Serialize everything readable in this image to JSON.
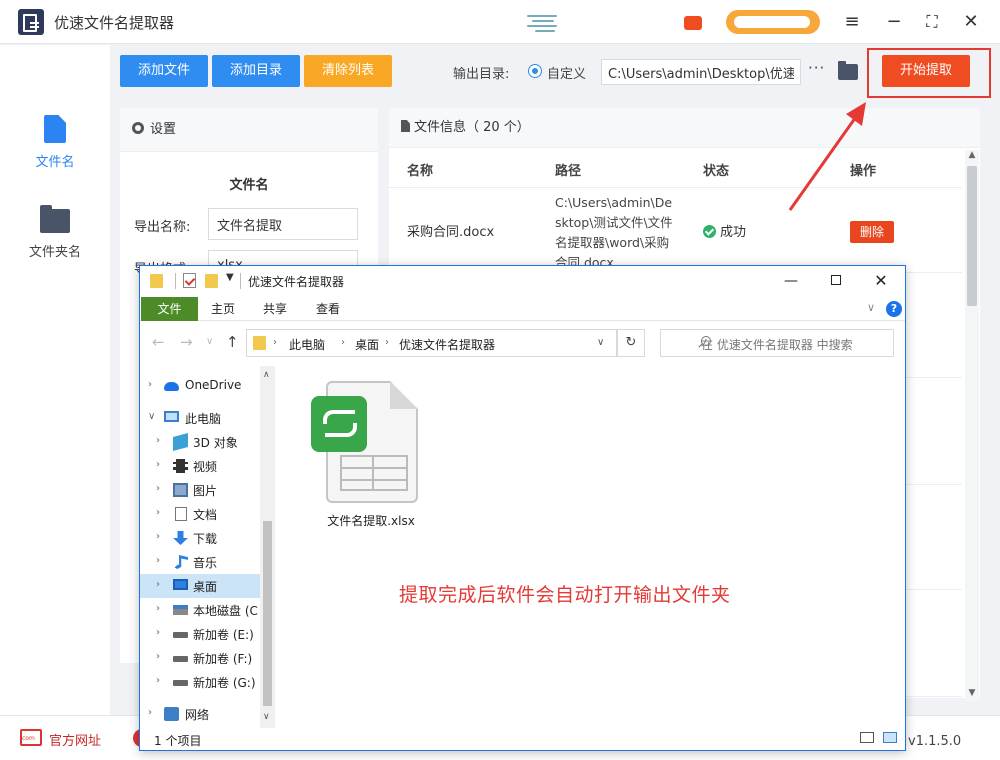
{
  "app": {
    "title": "优速文件名提取器"
  },
  "sidebar": {
    "items": [
      {
        "label": "文件名",
        "icon": "file-icon",
        "color": "#2c84f2"
      },
      {
        "label": "文件夹名",
        "icon": "folder-icon"
      }
    ]
  },
  "toolbar": {
    "add_file": "添加文件",
    "add_dir": "添加目录",
    "clear_list": "清除列表",
    "output_label": "输出目录:",
    "radio_custom": "自定义",
    "output_path": "C:\\Users\\admin\\Desktop\\优速",
    "more": "···",
    "start": "开始提取"
  },
  "settings": {
    "title": "设置",
    "subtitle": "文件名",
    "export_name_label": "导出名称:",
    "export_name_value": "文件名提取",
    "export_format_label": "导出格式:",
    "export_format_value": "xlsx"
  },
  "file_info": {
    "title": "文件信息（ 20 个）",
    "columns": [
      "名称",
      "路径",
      "状态",
      "操作"
    ],
    "rows": [
      {
        "name": "采购合同.docx",
        "path": "C:\\Users\\admin\\Desktop\\测试文件\\文件名提取器\\word\\采购合同.docx",
        "status": "成功",
        "action": "删除"
      }
    ]
  },
  "statusbar": {
    "website": "官方网址",
    "version": "本：v1.1.5.0"
  },
  "explorer": {
    "title": "优速文件名提取器",
    "ribbon_tabs": [
      "文件",
      "主页",
      "共享",
      "查看"
    ],
    "address": [
      "此电脑",
      "桌面",
      "优速文件名提取器"
    ],
    "search_placeholder": "在 优速文件名提取器 中搜索",
    "nav": [
      {
        "label": "OneDrive",
        "icon": "onedrive-icon"
      },
      {
        "label": "此电脑",
        "icon": "computer-icon"
      },
      {
        "label": "3D 对象",
        "icon": "3d-objects-icon"
      },
      {
        "label": "视频",
        "icon": "video-icon"
      },
      {
        "label": "图片",
        "icon": "pictures-icon"
      },
      {
        "label": "文档",
        "icon": "documents-icon"
      },
      {
        "label": "下载",
        "icon": "download-icon"
      },
      {
        "label": "音乐",
        "icon": "music-icon"
      },
      {
        "label": "桌面",
        "icon": "desktop-icon"
      },
      {
        "label": "本地磁盘 (C",
        "icon": "drive-c-icon"
      },
      {
        "label": "新加卷 (E:)",
        "icon": "drive-icon"
      },
      {
        "label": "新加卷 (F:)",
        "icon": "drive-icon"
      },
      {
        "label": "新加卷 (G:)",
        "icon": "drive-icon"
      },
      {
        "label": "网络",
        "icon": "network-icon"
      }
    ],
    "file": {
      "name": "文件名提取.xlsx",
      "icon": "spreadsheet-file-icon"
    },
    "notice": "提取完成后软件会自动打开输出文件夹",
    "status": "1 个项目"
  },
  "colors": {
    "accent_blue": "#2f8cf0",
    "orange": "#f9a825",
    "start_red": "#f04c22",
    "highlight_red": "#e53935",
    "success_green": "#2db36b"
  }
}
